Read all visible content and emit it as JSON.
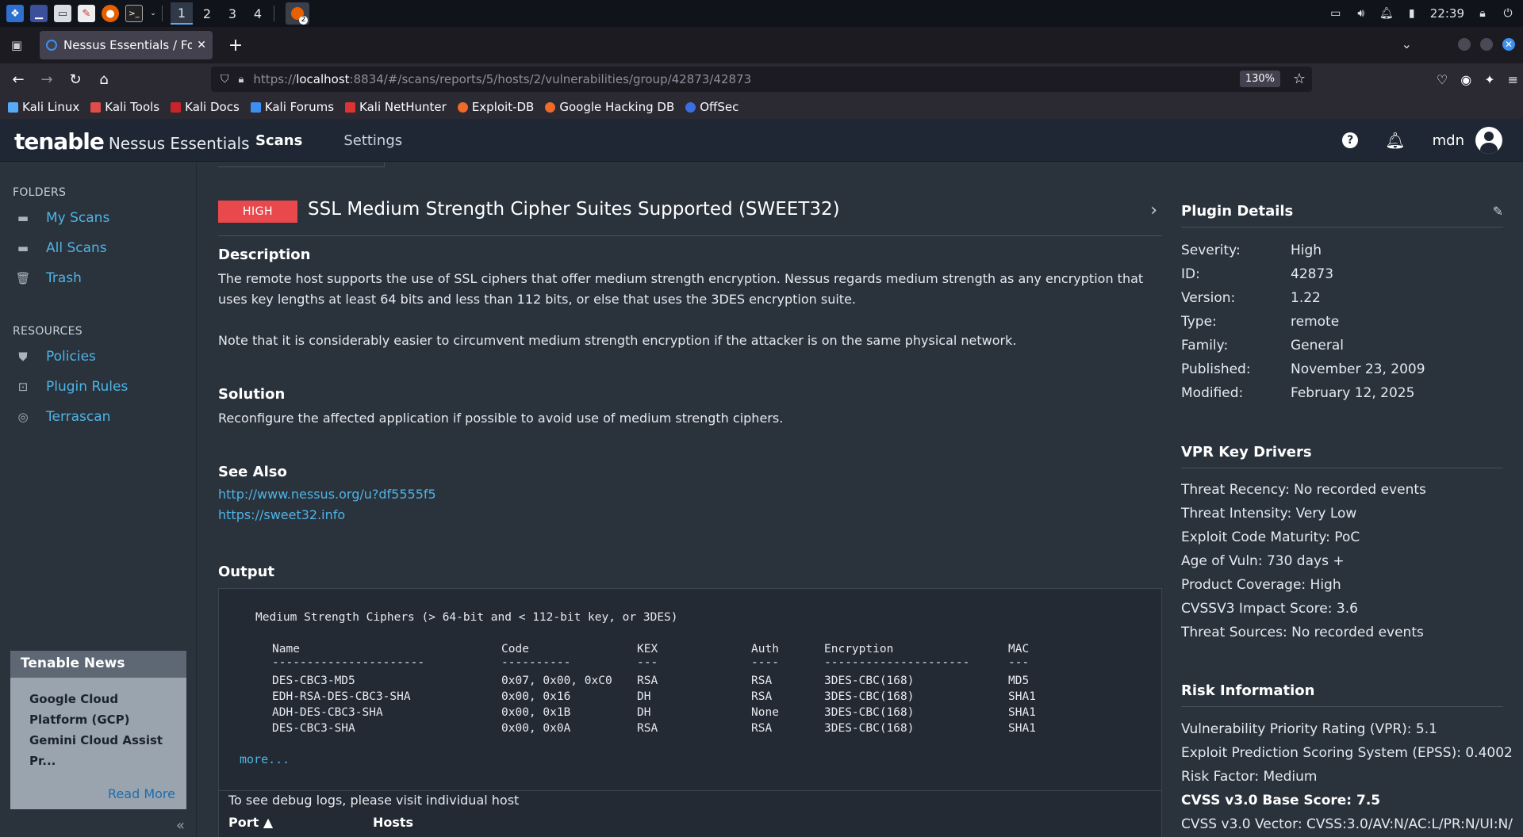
{
  "taskbar": {
    "workspaces": [
      "1",
      "2",
      "3",
      "4"
    ],
    "active_workspace": "1",
    "clock": "22:39",
    "notification_count": "2"
  },
  "browser": {
    "tab_title": "Nessus Essentials / Folders",
    "url_prefix": "https://",
    "url_host": "localhost",
    "url_rest": ":8834/#/scans/reports/5/hosts/2/vulnerabilities/group/42873/42873",
    "zoom": "130%",
    "bookmarks": [
      "Kali Linux",
      "Kali Tools",
      "Kali Docs",
      "Kali Forums",
      "Kali NetHunter",
      "Exploit-DB",
      "Google Hacking DB",
      "OffSec"
    ]
  },
  "app": {
    "logo_main": "tenable",
    "logo_sub": "Nessus Essentials",
    "nav": {
      "scans": "Scans",
      "settings": "Settings"
    },
    "username": "mdn",
    "help": "?"
  },
  "sidebar": {
    "folders_heading": "FOLDERS",
    "folders": [
      "My Scans",
      "All Scans",
      "Trash"
    ],
    "resources_heading": "RESOURCES",
    "resources": [
      "Policies",
      "Plugin Rules",
      "Terrascan"
    ],
    "news": {
      "heading": "Tenable News",
      "lines": [
        "Google Cloud",
        "Platform (GCP)",
        "Gemini Cloud Assist",
        "Pr..."
      ],
      "read_more": "Read More"
    }
  },
  "vuln": {
    "severity": "HIGH",
    "severity_color": "#e9494c",
    "title": "SSL Medium Strength Cipher Suites Supported (SWEET32)",
    "description_heading": "Description",
    "description_1": "The remote host supports the use of SSL ciphers that offer medium strength encryption. Nessus regards medium strength as any encryption that uses key lengths at least 64 bits and less than 112 bits, or else that uses the 3DES encryption suite.",
    "description_2": "Note that it is considerably easier to circumvent medium strength encryption if the attacker is on the same physical network.",
    "solution_heading": "Solution",
    "solution": "Reconfigure the affected application if possible to avoid use of medium strength ciphers.",
    "see_also_heading": "See Also",
    "see_also": [
      "http://www.nessus.org/u?df5555f5",
      "https://sweet32.info"
    ],
    "output_heading": "Output",
    "output": {
      "title": "Medium Strength Ciphers (> 64-bit and < 112-bit key, or 3DES)",
      "columns": [
        "Name",
        "Code",
        "KEX",
        "Auth",
        "Encryption",
        "MAC"
      ],
      "dashes": [
        "----------------------",
        "----------",
        "---",
        "----",
        "---------------------",
        "---"
      ],
      "rows": [
        [
          "DES-CBC3-MD5",
          "0x07, 0x00, 0xC0",
          "RSA",
          "RSA",
          "3DES-CBC(168)",
          "MD5"
        ],
        [
          "EDH-RSA-DES-CBC3-SHA",
          "0x00, 0x16",
          "DH",
          "RSA",
          "3DES-CBC(168)",
          "SHA1"
        ],
        [
          "ADH-DES-CBC3-SHA",
          "0x00, 0x1B",
          "DH",
          "None",
          "3DES-CBC(168)",
          "SHA1"
        ],
        [
          "DES-CBC3-SHA",
          "0x00, 0x0A",
          "RSA",
          "RSA",
          "3DES-CBC(168)",
          "SHA1"
        ]
      ],
      "more": "more..."
    },
    "debug_note": "To see debug logs, please visit individual host",
    "port_col": "Port ▲",
    "hosts_col": "Hosts"
  },
  "plugin_details": {
    "heading": "Plugin Details",
    "items": [
      {
        "k": "Severity:",
        "v": "High"
      },
      {
        "k": "ID:",
        "v": "42873"
      },
      {
        "k": "Version:",
        "v": "1.22"
      },
      {
        "k": "Type:",
        "v": "remote"
      },
      {
        "k": "Family:",
        "v": "General"
      },
      {
        "k": "Published:",
        "v": "November 23, 2009"
      },
      {
        "k": "Modified:",
        "v": "February 12, 2025"
      }
    ]
  },
  "vpr": {
    "heading": "VPR Key Drivers",
    "lines": [
      "Threat Recency: No recorded events",
      "Threat Intensity: Very Low",
      "Exploit Code Maturity: PoC",
      "Age of Vuln: 730 days +",
      "Product Coverage: High",
      "CVSSV3 Impact Score: 3.6",
      "Threat Sources: No recorded events"
    ]
  },
  "risk": {
    "heading": "Risk Information",
    "lines": [
      "Vulnerability Priority Rating (VPR): 5.1",
      "Exploit Prediction Scoring System (EPSS): 0.4002",
      "Risk Factor: Medium"
    ],
    "base_score": "CVSS v3.0 Base Score: 7.5",
    "vector": "CVSS v3.0 Vector: CVSS:3.0/AV:N/AC:L/PR:N/UI:N/"
  }
}
